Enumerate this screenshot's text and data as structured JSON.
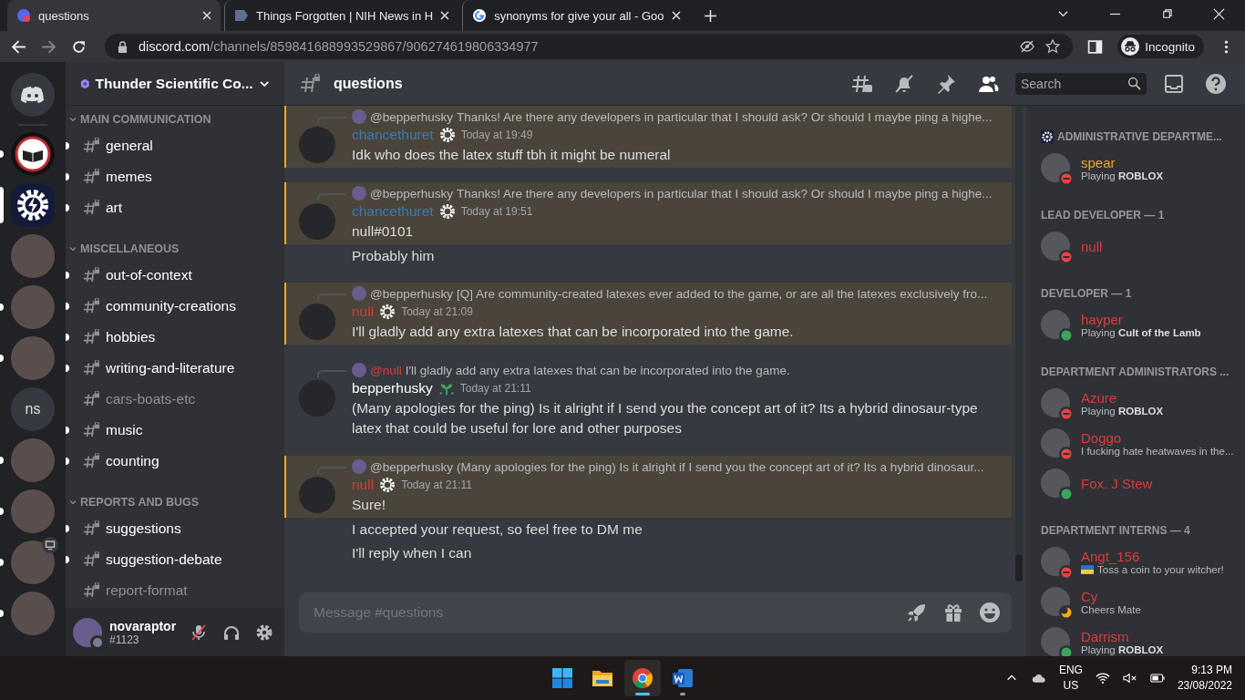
{
  "browser": {
    "tabs": [
      {
        "title": "questions",
        "selected": true,
        "kind": "discord"
      },
      {
        "title": "Things Forgotten | NIH News in H",
        "selected": false,
        "kind": "nih"
      },
      {
        "title": "synonyms for give your all - Goo",
        "selected": false,
        "kind": "google"
      }
    ],
    "url_host": "discord.com",
    "url_path": "/channels/859841688993529867/906274619806334977",
    "profile": "Incognito"
  },
  "servers": [
    {
      "kind": "emblem",
      "unread": true,
      "selected": false,
      "screen_share": false
    },
    {
      "kind": "gear",
      "unread": false,
      "selected": true,
      "screen_share": false
    },
    {
      "kind": "photo",
      "unread": false,
      "selected": false,
      "screen_share": false
    },
    {
      "kind": "photo",
      "unread": true,
      "selected": false,
      "screen_share": false
    },
    {
      "kind": "photo",
      "unread": true,
      "selected": false,
      "screen_share": false
    },
    {
      "kind": "initials",
      "initials": "ns",
      "unread": false,
      "selected": false,
      "screen_share": false
    },
    {
      "kind": "photo",
      "unread": true,
      "selected": false,
      "screen_share": false
    },
    {
      "kind": "photo",
      "unread": true,
      "selected": false,
      "screen_share": false
    },
    {
      "kind": "photo",
      "unread": true,
      "selected": false,
      "screen_share": true
    },
    {
      "kind": "photo",
      "unread": true,
      "selected": false,
      "screen_share": false
    }
  ],
  "server_name": "Thunder Scientific Co...",
  "categories": [
    {
      "name": "MAIN COMMUNICATION",
      "channels": [
        {
          "name": "general",
          "unread": true
        },
        {
          "name": "memes",
          "unread": true
        },
        {
          "name": "art",
          "unread": true
        }
      ]
    },
    {
      "name": "MISCELLANEOUS",
      "channels": [
        {
          "name": "out-of-context",
          "unread": true
        },
        {
          "name": "community-creations",
          "unread": true
        },
        {
          "name": "hobbies",
          "unread": true
        },
        {
          "name": "writing-and-literature",
          "unread": true
        },
        {
          "name": "cars-boats-etc",
          "unread": false
        },
        {
          "name": "music",
          "unread": true
        },
        {
          "name": "counting",
          "unread": true
        }
      ]
    },
    {
      "name": "REPORTS AND BUGS",
      "channels": [
        {
          "name": "suggestions",
          "unread": true
        },
        {
          "name": "suggestion-debate",
          "unread": true
        },
        {
          "name": "report-format",
          "unread": false
        }
      ]
    }
  ],
  "user": {
    "name": "novaraptor",
    "tag": "#1123",
    "mic_muted": true
  },
  "chat": {
    "channel": "questions",
    "search_placeholder": "Search",
    "input_placeholder": "Message #questions"
  },
  "messages": [
    {
      "mention": true,
      "reply": {
        "author": "@bepperhusky",
        "color": "#b9bbbe",
        "text": "Thanks! Are there any developers in particular that I should ask? Or should I maybe ping a highe..."
      },
      "author": "chancethuret",
      "color": "#3c7ab5",
      "kind": "gear",
      "time": "Today at 19:49",
      "text": "Idk who does the latex stuff tbh it might be numeral"
    },
    {
      "mention": true,
      "reply": {
        "author": "@bepperhusky",
        "color": "#b9bbbe",
        "text": "Thanks! Are there any developers in particular that I should ask? Or should I maybe ping a highe..."
      },
      "author": "chancethuret",
      "color": "#3c7ab5",
      "kind": "gear",
      "time": "Today at 19:51",
      "text": "null#0101",
      "followups": [
        "Probably him"
      ]
    },
    {
      "mention": true,
      "reply": {
        "author": "@bepperhusky",
        "color": "#b9bbbe",
        "text": "[Q] Are community-created latexes ever added to the game, or are all the latexes exclusively fro..."
      },
      "author": "null",
      "color": "#d83c3e",
      "kind": "gear",
      "time": "Today at 21:09",
      "text": "I'll gladly add any extra latexes that can be incorporated into the game."
    },
    {
      "mention": false,
      "reply": {
        "author": "@null",
        "color": "#d83c3e",
        "text": "I'll gladly add any extra latexes that can be incorporated into the game."
      },
      "author": "bepperhusky",
      "color": "#ffffff",
      "kind": "sprout",
      "time": "Today at 21:11",
      "text": "(Many apologies for the ping) Is it alright if I send you the concept art of it? Its a hybrid dinosaur-type latex that could be useful for lore and other purposes"
    },
    {
      "mention": true,
      "reply": {
        "author": "@bepperhusky",
        "color": "#b9bbbe",
        "text": "(Many apologies for the ping) Is it alright if I send you the concept art of it? Its a hybrid dinosaur..."
      },
      "author": "null",
      "color": "#d83c3e",
      "kind": "gear",
      "time": "Today at 21:11",
      "text": "Sure!",
      "followups": [
        "I accepted your request, so feel free to DM me",
        "I'll reply when I can"
      ]
    }
  ],
  "members": [
    {
      "title": "ADMINISTRATIVE DEPARTME...",
      "has_icon": true,
      "members": [
        {
          "name": "spear",
          "color": "#f0a532",
          "activity": "Playing **ROBLOX**",
          "kind": "dnd",
          "flag": false
        }
      ]
    },
    {
      "title": "LEAD DEVELOPER — 1",
      "has_icon": false,
      "members": [
        {
          "name": "null",
          "color": "#d83c3e",
          "kind": "dnd",
          "flag": false
        }
      ]
    },
    {
      "title": "DEVELOPER — 1",
      "has_icon": false,
      "members": [
        {
          "name": "hayper",
          "color": "#d83c3e",
          "activity": "Playing **Cult of the Lamb**",
          "kind": "online",
          "flag": false
        }
      ]
    },
    {
      "title": "DEPARTMENT ADMINISTRATORS ...",
      "has_icon": false,
      "members": [
        {
          "name": "Azure",
          "color": "#d83c3e",
          "activity": "Playing **ROBLOX**",
          "kind": "dnd",
          "flag": false
        },
        {
          "name": "Doggo",
          "color": "#d83c3e",
          "activity": "I fucking hate heatwaves in the...",
          "kind": "dnd",
          "flag": false
        },
        {
          "name": "Fox. J Stew",
          "color": "#d83c3e",
          "kind": "online",
          "flag": false
        }
      ]
    },
    {
      "title": "DEPARTMENT INTERNS — 4",
      "has_icon": false,
      "members": [
        {
          "name": "Angt_156",
          "color": "#d83c3e",
          "activity": "Toss a coin to your witcher!",
          "kind": "dnd",
          "flag": true
        },
        {
          "name": "Cy",
          "color": "#d83c3e",
          "activity": "Cheers Mate",
          "kind": "idle",
          "flag": false
        },
        {
          "name": "Darrism",
          "color": "#d83c3e",
          "activity": "Playing **ROBLOX**",
          "kind": "online",
          "flag": false
        }
      ]
    }
  ],
  "taskbar": {
    "apps": [
      {
        "kind": "start",
        "active": false,
        "running": false
      },
      {
        "kind": "explorer",
        "active": false,
        "running": false
      },
      {
        "kind": "chrome",
        "active": true,
        "running": true
      },
      {
        "kind": "word",
        "active": false,
        "running": true
      }
    ],
    "language": "ENG",
    "region": "US",
    "time": "9:13 PM",
    "date": "23/08/2022"
  }
}
